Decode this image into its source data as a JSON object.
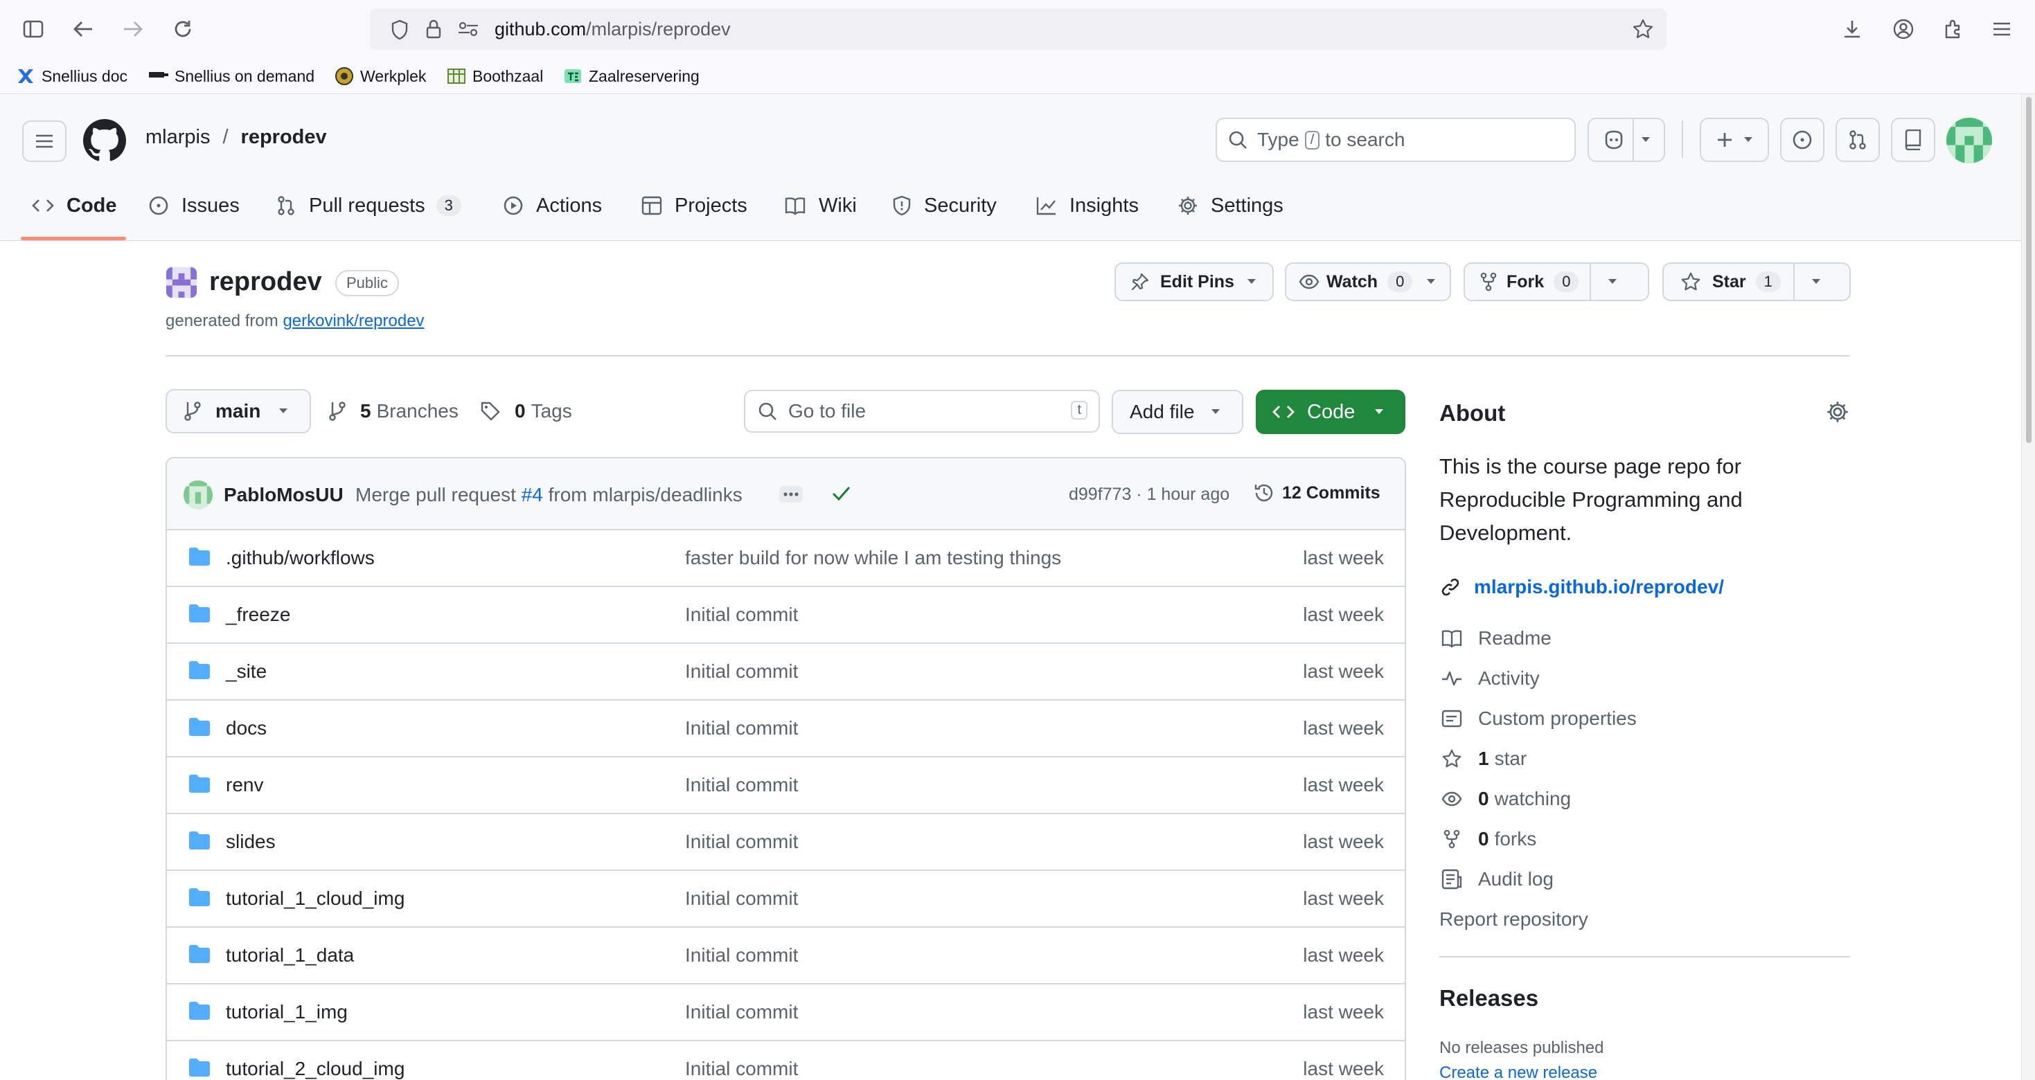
{
  "browser": {
    "url_host": "github.com",
    "url_path": "/mlarpis/reprodev",
    "bookmarks": [
      {
        "label": "Snellius doc"
      },
      {
        "label": "Snellius on demand"
      },
      {
        "label": "Werkplek"
      },
      {
        "label": "Boothzaal"
      },
      {
        "label": "Zaalreservering"
      }
    ]
  },
  "header": {
    "owner": "mlarpis",
    "separator": "/",
    "repo": "reprodev",
    "search_pre": "Type",
    "search_key": "/",
    "search_post": "to search"
  },
  "tabs": [
    {
      "label": "Code"
    },
    {
      "label": "Issues"
    },
    {
      "label": "Pull requests",
      "count": "3"
    },
    {
      "label": "Actions"
    },
    {
      "label": "Projects"
    },
    {
      "label": "Wiki"
    },
    {
      "label": "Security"
    },
    {
      "label": "Insights"
    },
    {
      "label": "Settings"
    }
  ],
  "repo": {
    "name": "reprodev",
    "visibility": "Public",
    "generated_prefix": "generated from",
    "generated_link": "gerkovink/reprodev"
  },
  "actions": {
    "edit_pins": "Edit Pins",
    "watch": "Watch",
    "watch_count": "0",
    "fork": "Fork",
    "fork_count": "0",
    "star": "Star",
    "star_count": "1"
  },
  "branchbar": {
    "branch": "main",
    "branches_count": "5",
    "branches_label": "Branches",
    "tags_count": "0",
    "tags_label": "Tags",
    "goto_placeholder": "Go to file",
    "goto_key": "t",
    "add_file": "Add file",
    "code": "Code"
  },
  "commit": {
    "author": "PabloMosUU",
    "message_pre": "Merge pull request",
    "pr": "#4",
    "message_post": "from mlarpis/deadlinks",
    "hash_time": "d99f773 · 1 hour ago",
    "commits_label": "12 Commits"
  },
  "files": [
    {
      "name": ".github/workflows",
      "message": "faster build for now while I am testing things",
      "date": "last week"
    },
    {
      "name": "_freeze",
      "message": "Initial commit",
      "date": "last week"
    },
    {
      "name": "_site",
      "message": "Initial commit",
      "date": "last week"
    },
    {
      "name": "docs",
      "message": "Initial commit",
      "date": "last week"
    },
    {
      "name": "renv",
      "message": "Initial commit",
      "date": "last week"
    },
    {
      "name": "slides",
      "message": "Initial commit",
      "date": "last week"
    },
    {
      "name": "tutorial_1_cloud_img",
      "message": "Initial commit",
      "date": "last week"
    },
    {
      "name": "tutorial_1_data",
      "message": "Initial commit",
      "date": "last week"
    },
    {
      "name": "tutorial_1_img",
      "message": "Initial commit",
      "date": "last week"
    },
    {
      "name": "tutorial_2_cloud_img",
      "message": "Initial commit",
      "date": "last week"
    }
  ],
  "about": {
    "title": "About",
    "description": "This is the course page repo for Reproducible Programming and Development.",
    "link": "mlarpis.github.io/reprodev/",
    "readme": "Readme",
    "activity": "Activity",
    "custom_properties": "Custom properties",
    "stars_count": "1",
    "stars_label": "star",
    "watching_count": "0",
    "watching_label": "watching",
    "forks_count": "0",
    "forks_label": "forks",
    "audit_log": "Audit log",
    "report": "Report repository"
  },
  "releases": {
    "title": "Releases",
    "none": "No releases published",
    "create": "Create a new release"
  },
  "colors": {
    "accent_green": "#1f883d",
    "link_blue": "#0969da",
    "folder_blue": "#54aeff",
    "tab_underline": "#fd8c73"
  }
}
